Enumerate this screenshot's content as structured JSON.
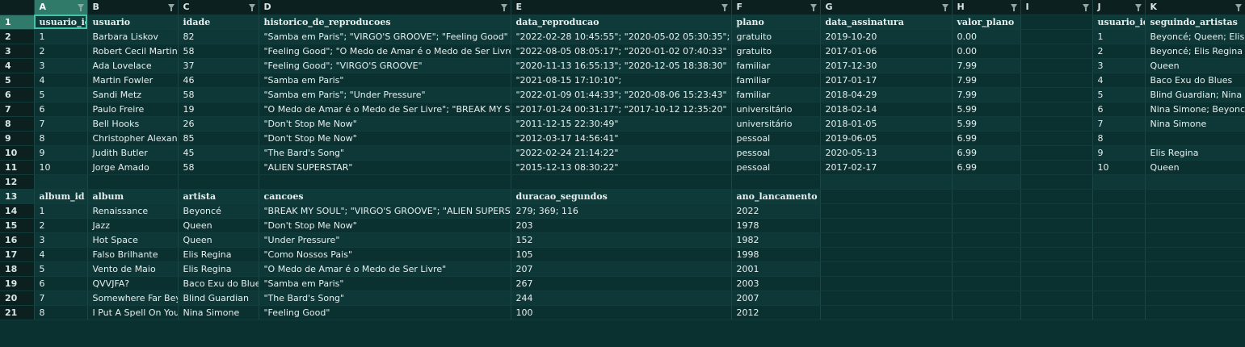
{
  "columns": [
    "A",
    "B",
    "C",
    "D",
    "E",
    "F",
    "G",
    "H",
    "I",
    "J",
    "K"
  ],
  "rows": [
    {
      "n": "1",
      "type": "hdr",
      "cells": [
        "usuario_id",
        "usuario",
        "idade",
        "historico_de_reproducoes",
        "data_reproducao",
        "plano",
        "data_assinatura",
        "valor_plano",
        "",
        "usuario_id",
        "seguindo_artistas"
      ]
    },
    {
      "n": "2",
      "cells": [
        "1",
        "Barbara Liskov",
        "82",
        "\"Samba em Paris\"; \"VIRGO'S GROOVE\"; \"Feeling Good\"",
        "\"2022-02-28 10:45:55\"; \"2020-05-02 05:30:35\"; \"2020-0",
        "gratuito",
        "2019-10-20",
        "0.00",
        "",
        "1",
        "Beyoncé; Queen; Elis Re"
      ]
    },
    {
      "n": "3",
      "cells": [
        "2",
        "Robert Cecil Martin",
        "58",
        "\"Feeling Good\"; \"O Medo de Amar é o Medo de Ser Livre\"",
        "\"2022-08-05 08:05:17\"; \"2020-01-02 07:40:33\"",
        "gratuito",
        "2017-01-06",
        "0.00",
        "",
        "2",
        "Beyoncé; Elis Regina"
      ]
    },
    {
      "n": "4",
      "cells": [
        "3",
        "Ada Lovelace",
        "37",
        "\"Feeling Good\"; \"VIRGO'S GROOVE\"",
        "\"2020-11-13 16:55:13\"; \"2020-12-05 18:38:30\"",
        "familiar",
        "2017-12-30",
        "7.99",
        "",
        "3",
        "Queen"
      ]
    },
    {
      "n": "5",
      "cells": [
        "4",
        "Martin Fowler",
        "46",
        "\"Samba em Paris\"",
        "\"2021-08-15 17:10:10\";",
        "familiar",
        "2017-01-17",
        "7.99",
        "",
        "4",
        "Baco Exu do Blues"
      ]
    },
    {
      "n": "6",
      "cells": [
        "5",
        "Sandi Metz",
        "58",
        "\"Samba em Paris\"; \"Under Pressure\"",
        "\"2022-01-09 01:44:33\"; \"2020-08-06 15:23:43\"",
        "familiar",
        "2018-04-29",
        "7.99",
        "",
        "5",
        "Blind Guardian; Nina Sim"
      ]
    },
    {
      "n": "7",
      "cells": [
        "6",
        "Paulo Freire",
        "19",
        "\"O Medo de Amar é o Medo de Ser Livre\"; \"BREAK MY SOUL\"",
        "\"2017-01-24 00:31:17\"; \"2017-10-12 12:35:20\"",
        "universitário",
        "2018-02-14",
        "5.99",
        "",
        "6",
        "Nina Simone; Beyoncé"
      ]
    },
    {
      "n": "8",
      "cells": [
        "7",
        "Bell Hooks",
        "26",
        "\"Don't Stop Me Now\"",
        "\"2011-12-15 22:30:49\"",
        "universitário",
        "2018-01-05",
        "5.99",
        "",
        "7",
        "Nina Simone"
      ]
    },
    {
      "n": "9",
      "cells": [
        "8",
        "Christopher Alexande",
        "85",
        "\"Don't Stop Me Now\"",
        "\"2012-03-17 14:56:41\"",
        "pessoal",
        "2019-06-05",
        "6.99",
        "",
        "8",
        ""
      ]
    },
    {
      "n": "10",
      "cells": [
        "9",
        "Judith Butler",
        "45",
        "\"The Bard's Song\"",
        "\"2022-02-24 21:14:22\"",
        "pessoal",
        "2020-05-13",
        "6.99",
        "",
        "9",
        "Elis Regina"
      ]
    },
    {
      "n": "11",
      "cells": [
        "10",
        "Jorge Amado",
        "58",
        "\"ALIEN SUPERSTAR\"",
        "\"2015-12-13 08:30:22\"",
        "pessoal",
        "2017-02-17",
        "6.99",
        "",
        "10",
        "Queen"
      ]
    },
    {
      "n": "12",
      "cells": [
        "",
        "",
        "",
        "",
        "",
        "",
        "",
        "",
        "",
        "",
        ""
      ]
    },
    {
      "n": "13",
      "type": "hdr",
      "cells": [
        "album_id",
        "album",
        "artista",
        "cancoes",
        "duracao_segundos",
        "ano_lancamento",
        "",
        "",
        "",
        "",
        ""
      ]
    },
    {
      "n": "14",
      "cells": [
        "1",
        "Renaissance",
        "Beyoncé",
        "\"BREAK MY SOUL\"; \"VIRGO'S GROOVE\"; \"ALIEN SUPERSTAR\"",
        "279; 369; 116",
        "2022",
        "",
        "",
        "",
        "",
        ""
      ]
    },
    {
      "n": "15",
      "cells": [
        "2",
        "Jazz",
        "Queen",
        "\"Don't Stop Me Now\"",
        "203",
        "1978",
        "",
        "",
        "",
        "",
        ""
      ]
    },
    {
      "n": "16",
      "cells": [
        "3",
        "Hot Space",
        "Queen",
        "\"Under Pressure\"",
        "152",
        "1982",
        "",
        "",
        "",
        "",
        ""
      ]
    },
    {
      "n": "17",
      "cells": [
        "4",
        "Falso Brilhante",
        "Elis Regina",
        "\"Como Nossos Pais\"",
        "105",
        "1998",
        "",
        "",
        "",
        "",
        ""
      ]
    },
    {
      "n": "18",
      "cells": [
        "5",
        "Vento de Maio",
        "Elis Regina",
        "\"O Medo de Amar é o Medo de Ser Livre\"",
        "207",
        "2001",
        "",
        "",
        "",
        "",
        ""
      ]
    },
    {
      "n": "19",
      "cells": [
        "6",
        "QVVJFA?",
        "Baco Exu do Blues",
        "\"Samba em Paris\"",
        "267",
        "2003",
        "",
        "",
        "",
        "",
        ""
      ]
    },
    {
      "n": "20",
      "cells": [
        "7",
        "Somewhere Far Beyo",
        "Blind Guardian",
        "\"The Bard's Song\"",
        "244",
        "2007",
        "",
        "",
        "",
        "",
        ""
      ]
    },
    {
      "n": "21",
      "cells": [
        "8",
        "I Put A Spell On You",
        "Nina Simone",
        "\"Feeling Good\"",
        "100",
        "2012",
        "",
        "",
        "",
        "",
        ""
      ]
    }
  ],
  "active_cell": "A1"
}
